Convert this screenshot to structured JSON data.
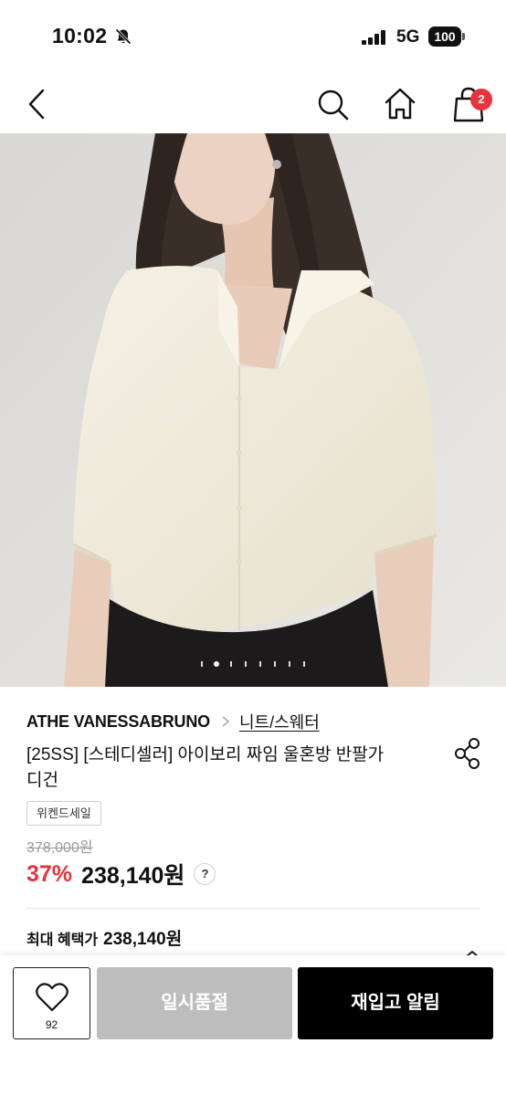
{
  "status_bar": {
    "time": "10:02",
    "network": "5G",
    "battery": "100"
  },
  "nav": {
    "cart_count": "2",
    "icons": [
      "back-icon",
      "search-icon",
      "home-icon",
      "cart-icon"
    ]
  },
  "gallery": {
    "image_count": 8,
    "current_index": 2
  },
  "product": {
    "brand": "ATHE VANESSABRUNO",
    "category": "니트/스웨터",
    "title_line1": "[25SS] [스테디셀러] 아이보리 짜임 울혼방 반팔가",
    "title_line2": "디건",
    "sale_tag": "위켄드세일",
    "original_price": "378,000원",
    "discount_rate": "37%",
    "sale_price": "238,140원",
    "help_label": "?",
    "max_benefit_label": "최대 혜택가",
    "max_benefit_price": "238,140원"
  },
  "bottom_bar": {
    "wish_count": "92",
    "soldout_label": "일시품절",
    "restock_label": "재입고 알림"
  },
  "colors": {
    "accent_red": "#e8323c",
    "soldout_gray": "#bdbdbd",
    "primary_black": "#000000"
  }
}
